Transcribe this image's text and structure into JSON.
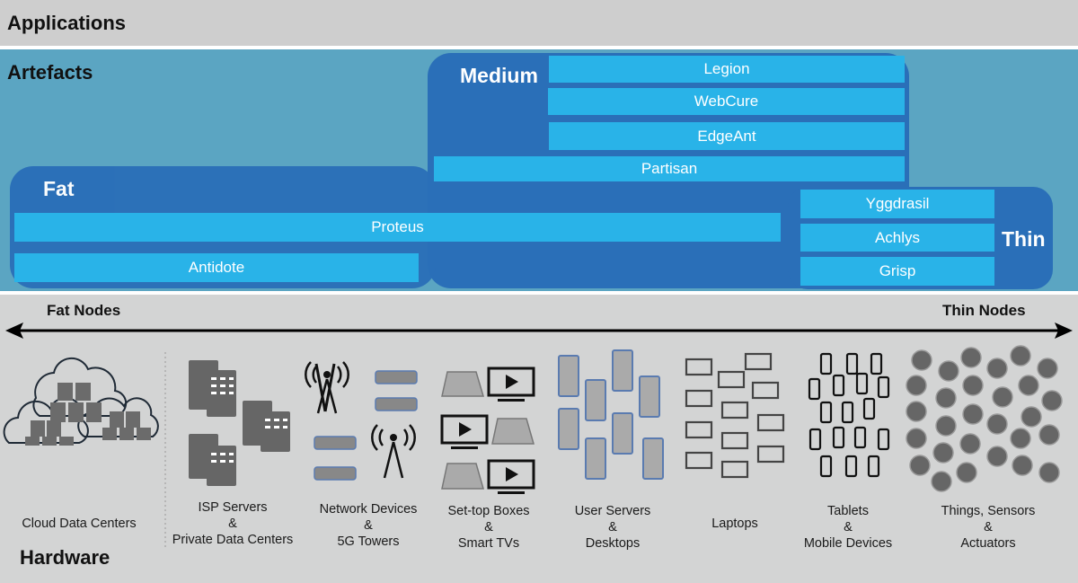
{
  "layers": {
    "applications": "Applications",
    "artefacts": "Artefacts",
    "hardware": "Hardware"
  },
  "groups": {
    "fat": {
      "label": "Fat",
      "items": [
        "Proteus",
        "Antidote"
      ]
    },
    "medium": {
      "label": "Medium",
      "items": [
        "Legion",
        "WebCure",
        "EdgeAnt",
        "Partisan"
      ]
    },
    "thin": {
      "label": "Thin",
      "items": [
        "Yggdrasil",
        "Achlys",
        "Grisp"
      ]
    }
  },
  "axis": {
    "left": "Fat Nodes",
    "right": "Thin Nodes"
  },
  "hardware_categories": [
    {
      "line1": "Cloud Data Centers",
      "line2": "",
      "line3": "",
      "icon": "cloud-datacenter-icon"
    },
    {
      "line1": "ISP Servers",
      "line2": "&",
      "line3": "Private Data Centers",
      "icon": "server-building-icon"
    },
    {
      "line1": "Network Devices",
      "line2": "&",
      "line3": "5G Towers",
      "icon": "tower-icon"
    },
    {
      "line1": "Set-top Boxes",
      "line2": "&",
      "line3": "Smart TVs",
      "icon": "tv-icon"
    },
    {
      "line1": "User Servers",
      "line2": "&",
      "line3": "Desktops",
      "icon": "desktop-tower-icon"
    },
    {
      "line1": "Laptops",
      "line2": "",
      "line3": "",
      "icon": "laptop-icon"
    },
    {
      "line1": "Tablets",
      "line2": "&",
      "line3": "Mobile Devices",
      "icon": "phone-icon"
    },
    {
      "line1": "Things, Sensors",
      "line2": "&",
      "line3": "Actuators",
      "icon": "iot-chip-icon"
    }
  ],
  "colors": {
    "group": "#2a6fb8",
    "bar": "#29b3e8",
    "artefacts_bg": "#5ba5c2",
    "layer_bg": "#cecece"
  }
}
